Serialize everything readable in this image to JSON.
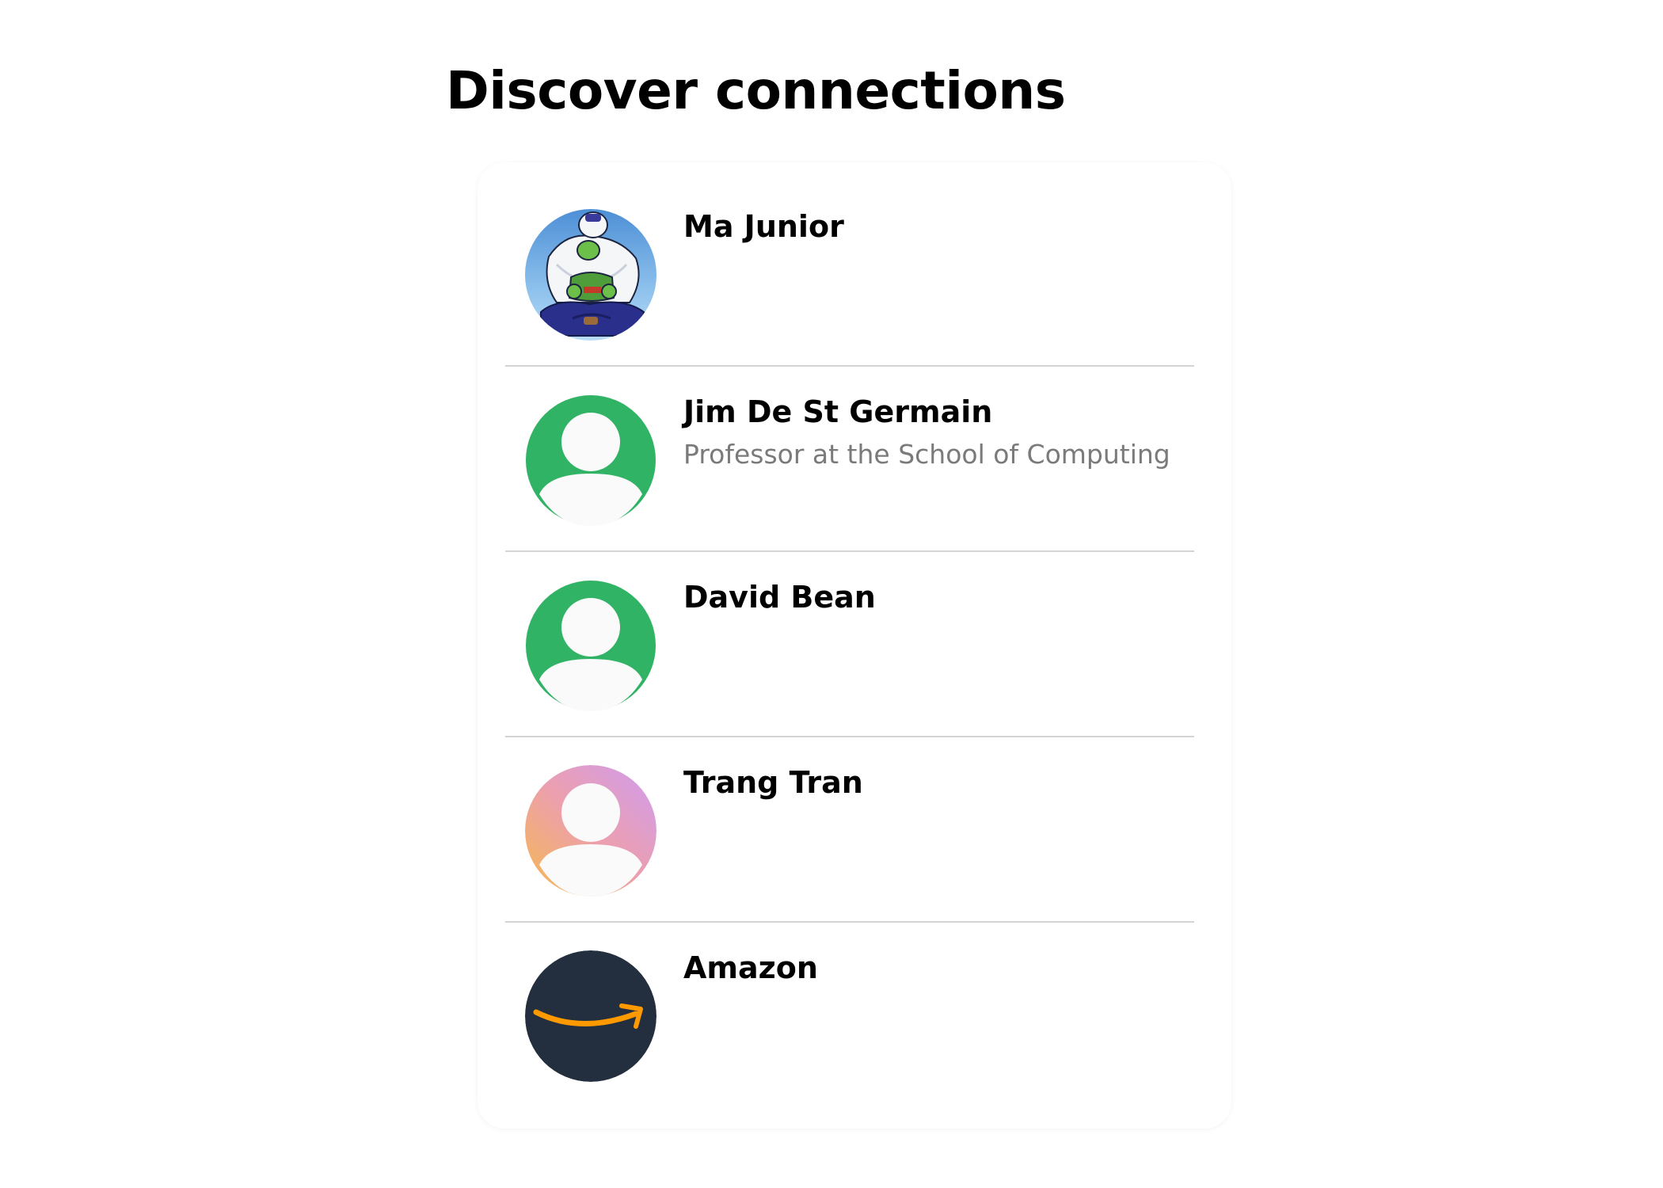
{
  "page": {
    "title": "Discover connections"
  },
  "connections": [
    {
      "name": "Ma Junior",
      "subtitle": "",
      "avatar": "anime-character-photo"
    },
    {
      "name": "Jim De St Germain",
      "subtitle": "Professor at the School of Computing",
      "avatar": "default-person-icon-green"
    },
    {
      "name": "David Bean",
      "subtitle": "",
      "avatar": "default-person-icon-green"
    },
    {
      "name": "Trang Tran",
      "subtitle": "",
      "avatar": "default-person-icon-gradient"
    },
    {
      "name": "Amazon",
      "subtitle": "",
      "avatar": "amazon-smile-logo"
    }
  ],
  "colors": {
    "avatar_green": "#31b366",
    "avatar_gradient_start": "#f5b94f",
    "avatar_gradient_mid": "#ec9fae",
    "avatar_gradient_end": "#cf9cf0",
    "amazon_background": "#232f3e",
    "amazon_smile": "#ff9900",
    "subtitle_text": "#7a7a7a",
    "divider": "#d4d4d4"
  }
}
